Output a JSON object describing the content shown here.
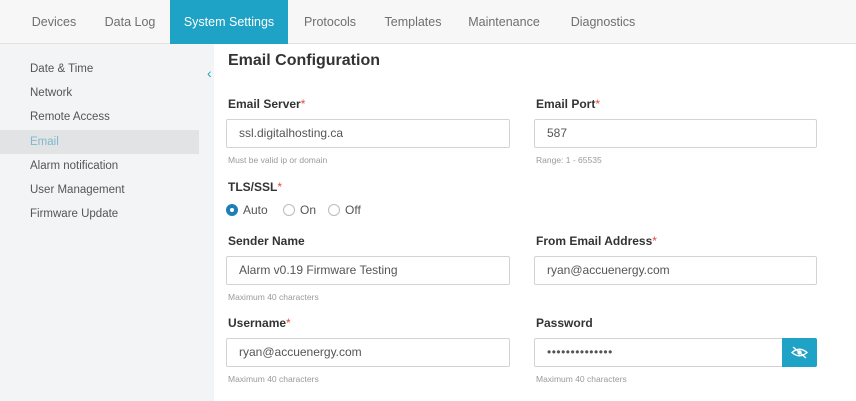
{
  "tabs": [
    {
      "label": "Devices"
    },
    {
      "label": "Data Log"
    },
    {
      "label": "System Settings"
    },
    {
      "label": "Protocols"
    },
    {
      "label": "Templates"
    },
    {
      "label": "Maintenance"
    },
    {
      "label": "Diagnostics"
    }
  ],
  "active_tab": "System Settings",
  "sidebar": {
    "items": [
      {
        "label": "Date & Time"
      },
      {
        "label": "Network"
      },
      {
        "label": "Remote Access"
      },
      {
        "label": "Email"
      },
      {
        "label": "Alarm notification"
      },
      {
        "label": "User Management"
      },
      {
        "label": "Firmware Update"
      }
    ],
    "active": "Email"
  },
  "page": {
    "title": "Email Configuration"
  },
  "form": {
    "required_mark": "*",
    "email_server": {
      "label": "Email Server",
      "value": "ssl.digitalhosting.ca",
      "hint": "Must be valid ip or domain"
    },
    "email_port": {
      "label": "Email Port",
      "value": "587",
      "hint": "Range: 1 - 65535"
    },
    "tls": {
      "label": "TLS/SSL",
      "options": [
        "Auto",
        "On",
        "Off"
      ],
      "selected": "Auto"
    },
    "sender_name": {
      "label": "Sender Name",
      "value": "Alarm v0.19 Firmware Testing",
      "hint": "Maximum 40 characters"
    },
    "from_address": {
      "label": "From Email Address",
      "value": "ryan@accuenergy.com"
    },
    "username": {
      "label": "Username",
      "value": "ryan@accuenergy.com",
      "hint": "Maximum 40 characters"
    },
    "password": {
      "label": "Password",
      "value": "••••••••••••••",
      "hint": "Maximum 40 characters"
    }
  },
  "icons": {
    "collapse": "chevron-left-icon",
    "toggle_password": "eye-off-icon"
  },
  "colors": {
    "accent": "#1ea2c6",
    "required": "#e14b3b",
    "radio_selected": "#1e7fb8"
  }
}
